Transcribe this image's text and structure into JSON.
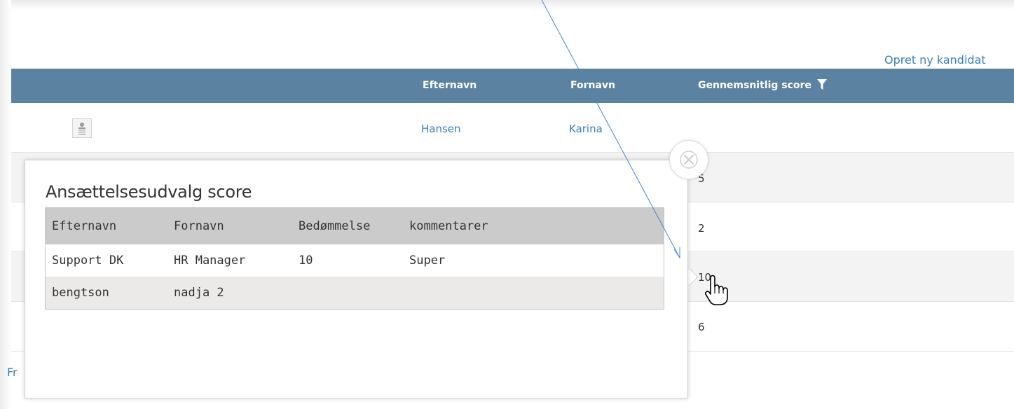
{
  "toolbar": {
    "create_link": "Opret ny kandidat"
  },
  "grid": {
    "columns": {
      "lastname": "Efternavn",
      "firstname": "Fornavn",
      "avg_score": "Gennemsnitlig score"
    },
    "rows": [
      {
        "lastname": "Hansen",
        "firstname": "Karina",
        "score": ""
      },
      {
        "score": "5"
      },
      {
        "score": "2"
      },
      {
        "score": "10"
      },
      {
        "score": "6"
      }
    ]
  },
  "footer": {
    "truncated_link": "Fr"
  },
  "popup": {
    "title": "Ansættelsesudvalg score",
    "columns": {
      "lastname": "Efternavn",
      "firstname": "Fornavn",
      "rating": "Bedømmelse",
      "comments": "kommentarer"
    },
    "rows": [
      {
        "lastname": "Support DK",
        "firstname": "HR Manager",
        "rating": "10",
        "comments": "Super"
      },
      {
        "lastname": "bengtson",
        "firstname": "nadja 2",
        "rating": "",
        "comments": ""
      }
    ]
  },
  "icons": {
    "filter": "filter-icon",
    "avatar": "person-placeholder-icon",
    "close": "close-icon",
    "cursor": "hand-pointer-icon"
  },
  "colors": {
    "header_bg": "#5b82a1",
    "link": "#3a7fc0",
    "popup_header_bg": "#cbcbcb",
    "popup_alt_row": "#ece9e9",
    "annotation_line": "#4a86c5"
  }
}
